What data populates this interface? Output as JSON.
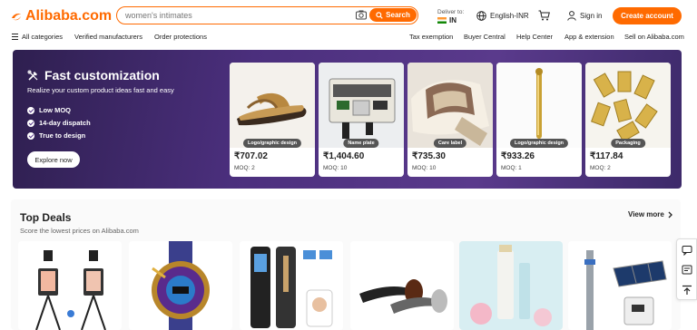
{
  "header": {
    "logo_text": "Alibaba.com",
    "search_placeholder": "women's intimates",
    "search_button": "Search",
    "deliver_label": "Deliver to:",
    "deliver_country": "IN",
    "language": "English-INR",
    "sign_in": "Sign in",
    "create_account": "Create account"
  },
  "nav": {
    "left": [
      "All categories",
      "Verified manufacturers",
      "Order protections"
    ],
    "right": [
      "Tax exemption",
      "Buyer Central",
      "Help Center",
      "App & extension",
      "Sell on Alibaba.com"
    ]
  },
  "banner": {
    "title": "Fast customization",
    "subtitle": "Realize your custom product ideas fast and easy",
    "bullets": [
      "Low MOQ",
      "14-day dispatch",
      "True to design"
    ],
    "cta": "Explore now",
    "cards": [
      {
        "tag": "Logo/graphic design",
        "price": "₹707.02",
        "moq": "MOQ: 2",
        "icon": "sandal-image"
      },
      {
        "tag": "Name plate",
        "price": "₹1,404.60",
        "moq": "MOQ: 10",
        "icon": "circuit-board-image"
      },
      {
        "tag": "Care label",
        "price": "₹735.30",
        "moq": "MOQ: 10",
        "icon": "fabric-label-image"
      },
      {
        "tag": "Logo/graphic design",
        "price": "₹933.26",
        "moq": "MOQ: 1",
        "icon": "gold-pen-image"
      },
      {
        "tag": "Packaging",
        "price": "₹117.84",
        "moq": "MOQ: 2",
        "icon": "gold-bars-packaging-image"
      }
    ]
  },
  "top_deals": {
    "title": "Top Deals",
    "subtitle": "Score the lowest prices on Alibaba.com",
    "view_more": "View more",
    "items": [
      "vlog-tripod-kit-image",
      "sport-watch-image",
      "smart-door-lock-image",
      "smoking-pipes-image",
      "skincare-bottle-image",
      "solar-pump-image"
    ]
  },
  "colors": {
    "accent": "#ff6a00",
    "banner": "#4b2f7d"
  }
}
